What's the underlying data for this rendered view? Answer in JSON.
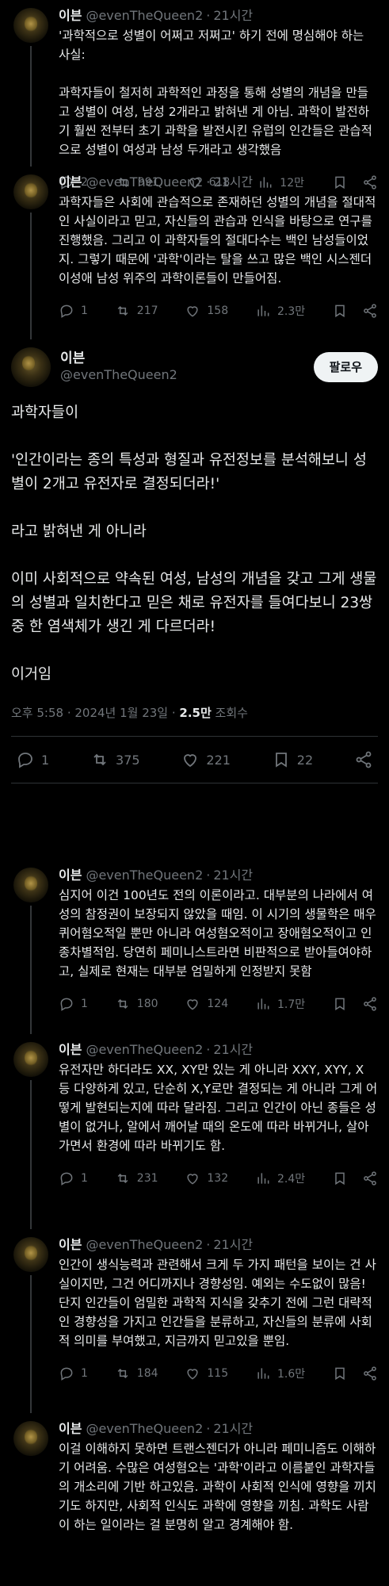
{
  "thread": {
    "author": {
      "name": "이븐",
      "handle": "@evenTheQueen2"
    },
    "top_posts": [
      {
        "time": "21시간",
        "text": "'과학적으로 성별이 어쩌고 저쩌고' 하기 전에 명심해야 하는 사실:\n\n과학자들이 철저히 과학적인 과정을 통해 성별의 개념을 만들고 성별이 여성, 남성 2개라고 밝혀낸 게 아님. 과학이 발전하기 훨씬 전부터 초기 과학을 발전시킨 유럽의 인간들은 관습적으로 성별이 여성과 남성 두개라고 생각했음",
        "replies": "2",
        "reposts": "991",
        "likes": "618",
        "views": "12만"
      },
      {
        "time": "21시간",
        "text": "과학자들은 사회에 관습적으로 존재하던 성별의 개념을 절대적인 사실이라고 믿고, 자신들의 관습과 인식을 바탕으로 연구를 진행했음. 그리고 이 과학자들의 절대다수는 백인 남성들이었지. 그렇기 때문에 '과학'이라는 탈을 쓰고 많은 백인 시스젠더 이성애 남성 위주의 과학이론들이 만들어짐.",
        "replies": "1",
        "reposts": "217",
        "likes": "158",
        "views": "2.3만"
      }
    ],
    "main_post": {
      "follow_label": "팔로우",
      "text": "과학자들이\n\n'인간이라는 종의 특성과 형질과 유전정보를 분석해보니 성별이 2개고 유전자로 결정되더라!'\n\n라고 밝혀낸 게 아니라\n\n이미 사회적으로 약속된 여성, 남성의 개념을 갖고 그게 생물의 성별과 일치한다고 믿은 채로 유전자를 들여다보니 23쌍 중 한 염색체가 생긴 게 다르더라!\n\n이거임",
      "timestamp": "오후 5:58 · 2024년 1월 23일 · ",
      "views_bold": "2.5만",
      "views_suffix": " 조회수",
      "replies": "1",
      "reposts": "375",
      "likes": "221",
      "bookmarks": "22"
    },
    "reply_posts": [
      {
        "time": "21시간",
        "text": "심지어 이건 100년도 전의 이론이라고. 대부분의 나라에서 여성의 참정권이 보장되지 않았을 때임. 이 시기의 생물학은 매우 퀴어혐오적일 뿐만 아니라 여성혐오적이고 장애혐오적이고 인종차별적임. 당연히 페미니스트라면 비판적으로 받아들여야하고, 실제로 현재는 대부분 엄밀하게 인정받지 못함",
        "replies": "1",
        "reposts": "180",
        "likes": "124",
        "views": "1.7만"
      },
      {
        "time": "21시간",
        "text": "유전자만 하더라도 XX, XY만 있는 게 아니라 XXY, XYY, X 등 다양하게 있고, 단순히 X,Y로만 결정되는 게 아니라 그게 어떻게 발현되는지에 따라 달라짐. 그리고 인간이 아닌 종들은 성별이 없거나, 알에서 깨어날 때의 온도에 따라 바뀌거나, 살아가면서 환경에 따라 바뀌기도 함.",
        "replies": "1",
        "reposts": "231",
        "likes": "132",
        "views": "2.4만"
      },
      {
        "time": "21시간",
        "text": "인간이 생식능력과 관련해서 크게 두 가지 패턴을 보이는 건 사실이지만, 그건 어디까지나 경향성임. 예외는 수도없이 많음! 단지 인간들이 엄밀한 과학적 지식을 갖추기 전에 그런 대략적인 경향성을 가지고 인간들을 분류하고, 자신들의 분류에 사회적 의미를 부여했고, 지금까지 믿고있을 뿐임.",
        "replies": "1",
        "reposts": "184",
        "likes": "115",
        "views": "1.6만"
      },
      {
        "time": "21시간",
        "text": "이걸 이해하지 못하면 트랜스젠더가 아니라 페미니즘도 이해하기 어려움. 수많은 여성혐오는 '과학'이라고 이름붙인 과학자들의 개소리에 기반 하고있음. 과학이 사회적 인식에 영향을 끼치기도 하지만, 사회적 인식도 과학에 영향을 끼침. 과학도 사람이 하는 일이라는 걸 분명히 알고 경계해야 함."
      }
    ]
  }
}
